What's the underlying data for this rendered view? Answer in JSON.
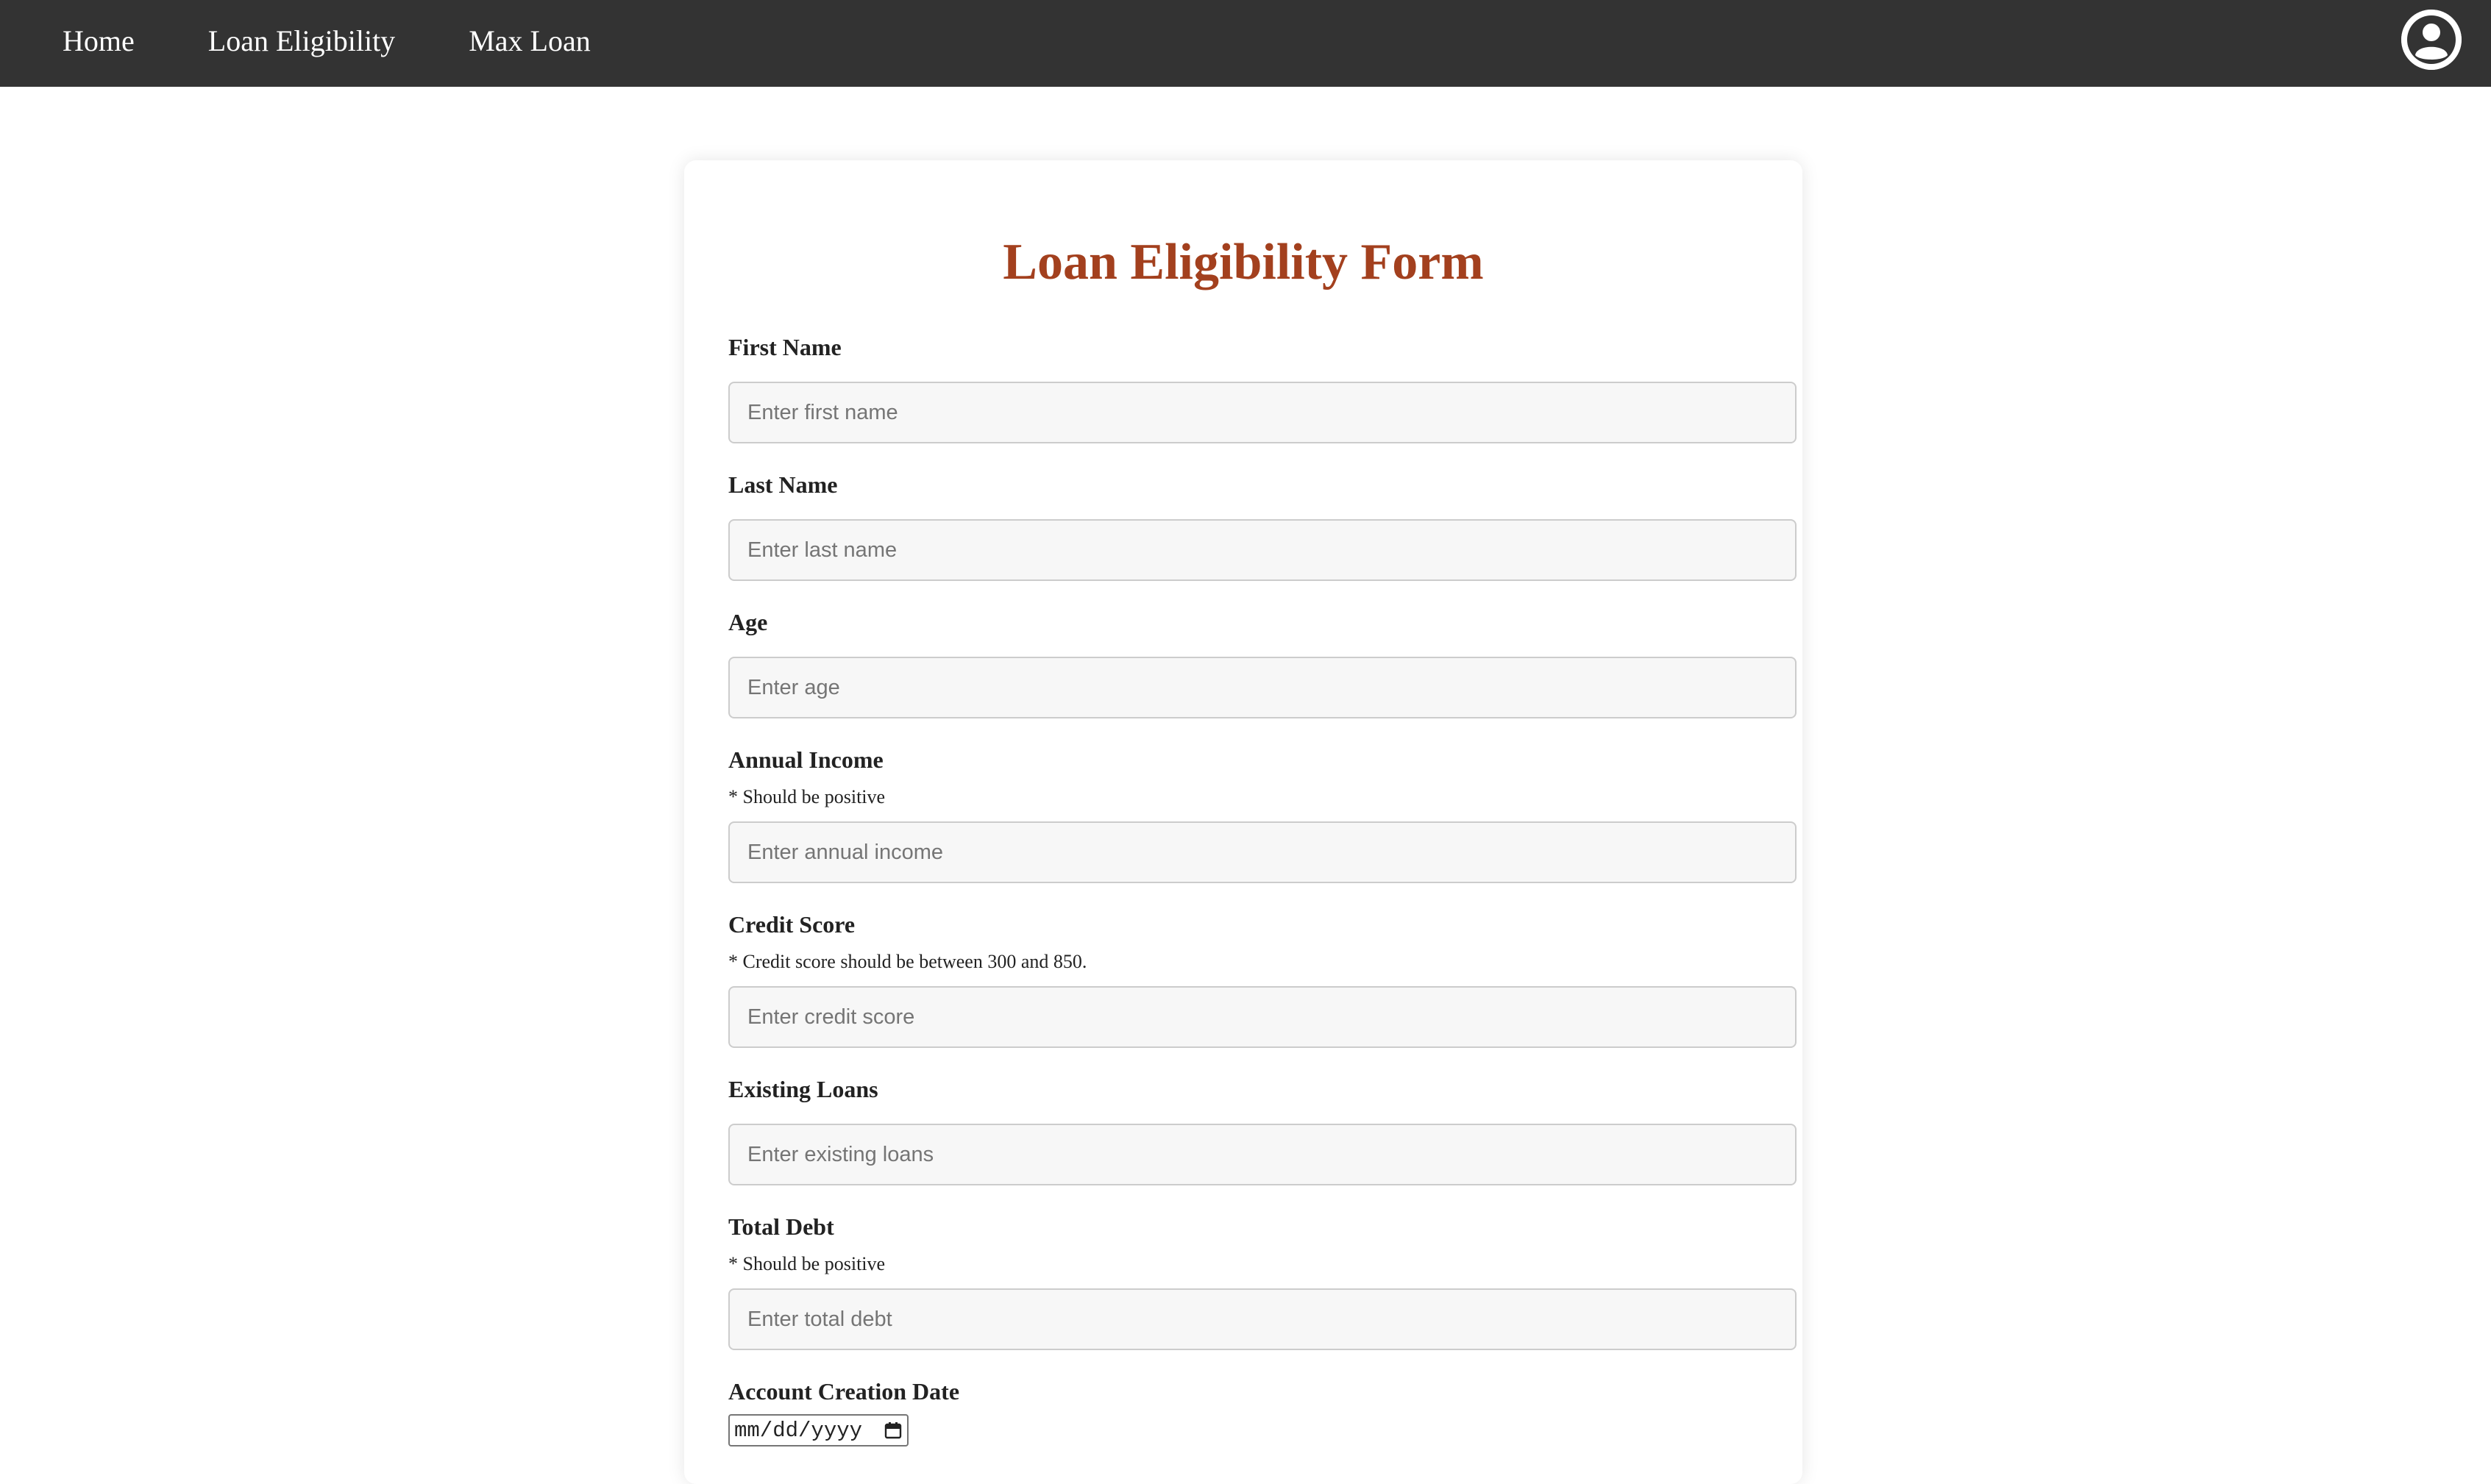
{
  "nav": {
    "links": [
      {
        "label": "Home"
      },
      {
        "label": "Loan Eligibility"
      },
      {
        "label": "Max Loan"
      }
    ],
    "avatar_icon": "user-circle-icon"
  },
  "form": {
    "title": "Loan Eligibility Form",
    "title_color": "#a3401e",
    "fields": [
      {
        "label": "First Name",
        "note": "",
        "placeholder": "Enter first name",
        "value": ""
      },
      {
        "label": "Last Name",
        "note": "",
        "placeholder": "Enter last name",
        "value": ""
      },
      {
        "label": "Age",
        "note": "",
        "placeholder": "Enter age",
        "value": ""
      },
      {
        "label": "Annual Income",
        "note": "* Should be positive",
        "placeholder": "Enter annual income",
        "value": ""
      },
      {
        "label": "Credit Score",
        "note": "* Credit score should be between 300 and 850.",
        "placeholder": "Enter credit score",
        "value": ""
      },
      {
        "label": "Existing Loans",
        "note": "",
        "placeholder": "Enter existing loans",
        "value": ""
      },
      {
        "label": "Total Debt",
        "note": "* Should be positive",
        "placeholder": "Enter total debt",
        "value": ""
      }
    ],
    "account_creation": {
      "label": "Account Creation Date",
      "value": "mm/dd/yyyy",
      "icon": "calendar-icon"
    }
  },
  "colors": {
    "navbar_bg": "#333333",
    "accent": "#a3401e",
    "input_bg": "#f7f7f7",
    "input_border": "#cccccc"
  }
}
